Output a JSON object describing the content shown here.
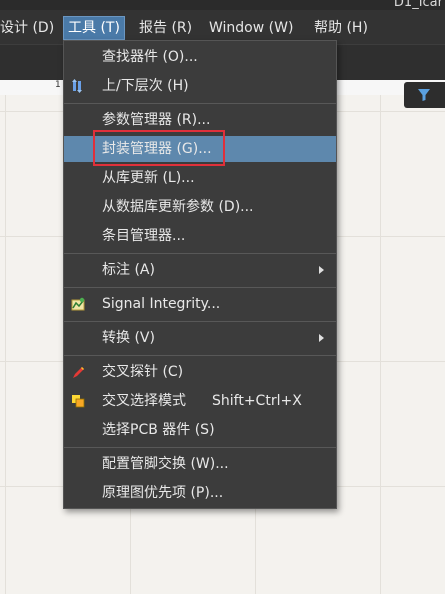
{
  "window": {
    "title": "D1_Icar"
  },
  "menubar": {
    "items": [
      {
        "label": "设计 (D)"
      },
      {
        "label": "工具 (T)"
      },
      {
        "label": "报告 (R)"
      },
      {
        "label": "Window (W)"
      },
      {
        "label": "帮助 (H)"
      }
    ]
  },
  "ruler": {
    "mark": "1"
  },
  "toolbar": {
    "filter_icon": "filter-icon"
  },
  "tools_menu": {
    "items": [
      {
        "label": "查找器件 (O)..."
      },
      {
        "label": "上/下层次 (H)",
        "icon": "hierarchy-icon"
      },
      {
        "label": "参数管理器 (R)..."
      },
      {
        "label": "封装管理器 (G)...",
        "selected": true
      },
      {
        "label": "从库更新 (L)..."
      },
      {
        "label": "从数据库更新参数 (D)..."
      },
      {
        "label": "条目管理器..."
      },
      {
        "label": "标注 (A)",
        "submenu": true
      },
      {
        "label": "Signal Integrity...",
        "icon": "signal-integrity-icon"
      },
      {
        "label": "转换 (V)",
        "submenu": true
      },
      {
        "label": "交叉探针 (C)",
        "icon": "cross-probe-icon"
      },
      {
        "label": "交叉选择模式",
        "shortcut": "Shift+Ctrl+X",
        "icon": "cross-select-icon"
      },
      {
        "label": "选择PCB 器件 (S)"
      },
      {
        "label": "配置管脚交换 (W)..."
      },
      {
        "label": "原理图优先项 (P)..."
      }
    ]
  },
  "colors": {
    "menu_bg": "#3c3c3c",
    "selected_bg": "#5e88ad",
    "annotation_box": "#e0303a"
  }
}
